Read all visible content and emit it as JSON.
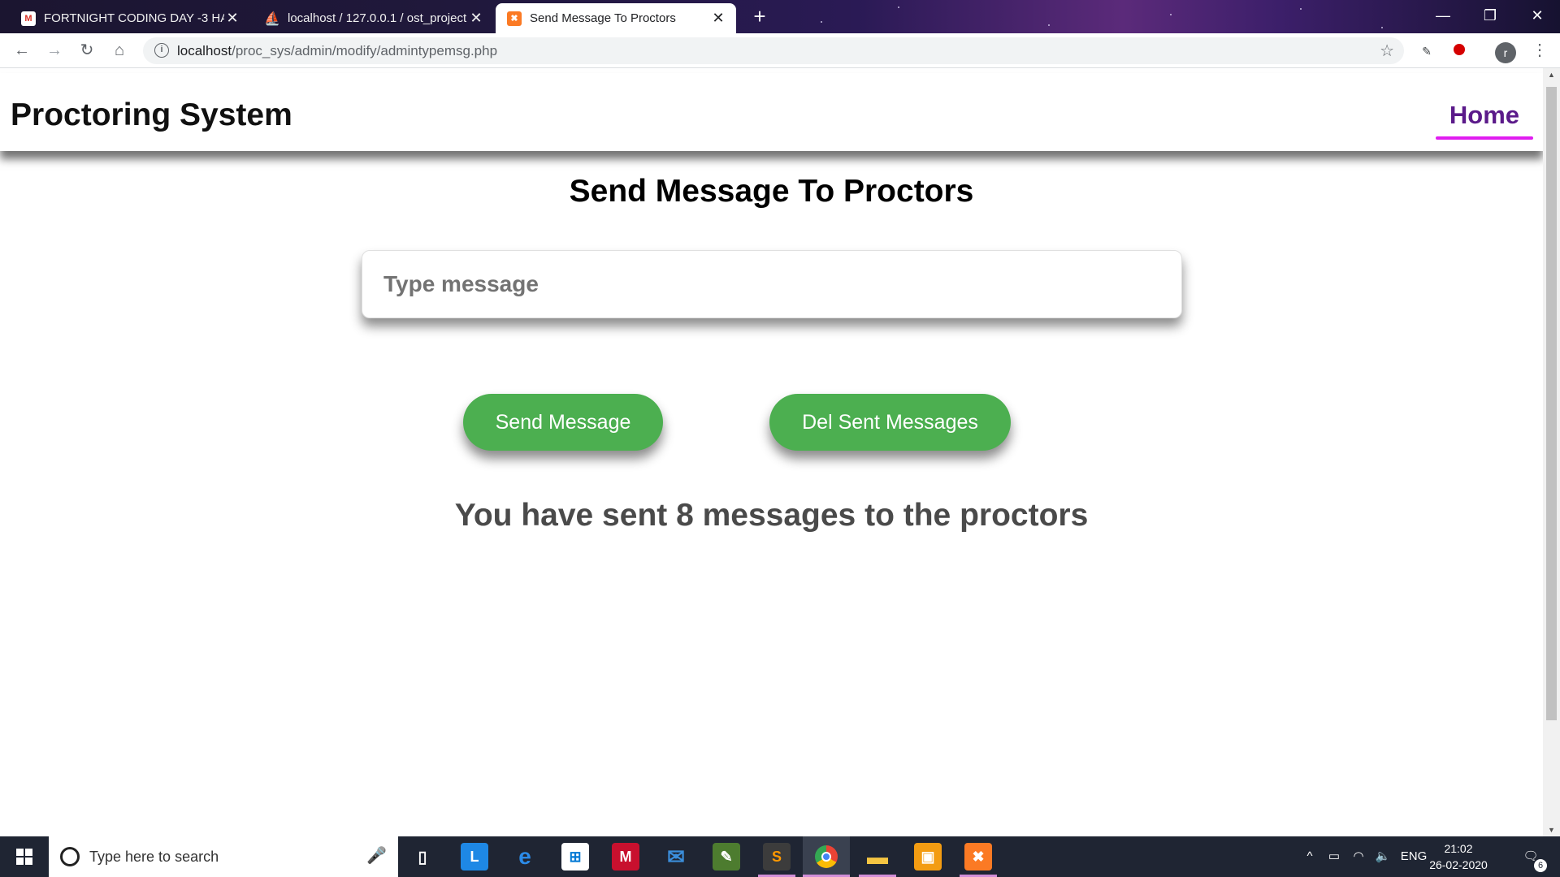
{
  "browser": {
    "tabs": [
      {
        "title": "FORTNIGHT CODING DAY -3 HAC",
        "favicon": "gmail-icon"
      },
      {
        "title": "localhost / 127.0.0.1 / ost_project",
        "favicon": "phpmyadmin-icon"
      },
      {
        "title": "Send Message To Proctors",
        "favicon": "xampp-icon"
      }
    ],
    "url_host": "localhost",
    "url_path": "/proc_sys/admin/modify/admintypemsg.php"
  },
  "page": {
    "brand": "Proctoring System",
    "nav_home": "Home",
    "heading": "Send Message To Proctors",
    "message_placeholder": "Type message",
    "send_button": "Send Message",
    "delete_button": "Del Sent Messages",
    "status_text": "You have sent 8 messages to the proctors"
  },
  "colors": {
    "button_green": "#4caf50",
    "home_link": "#5b1a8a",
    "home_underline": "#e01cf0"
  },
  "profile": {
    "initial": "r"
  },
  "taskbar": {
    "search_placeholder": "Type here to search",
    "language": "ENG",
    "time": "21:02",
    "date": "26-02-2020",
    "notification_count": "6"
  }
}
